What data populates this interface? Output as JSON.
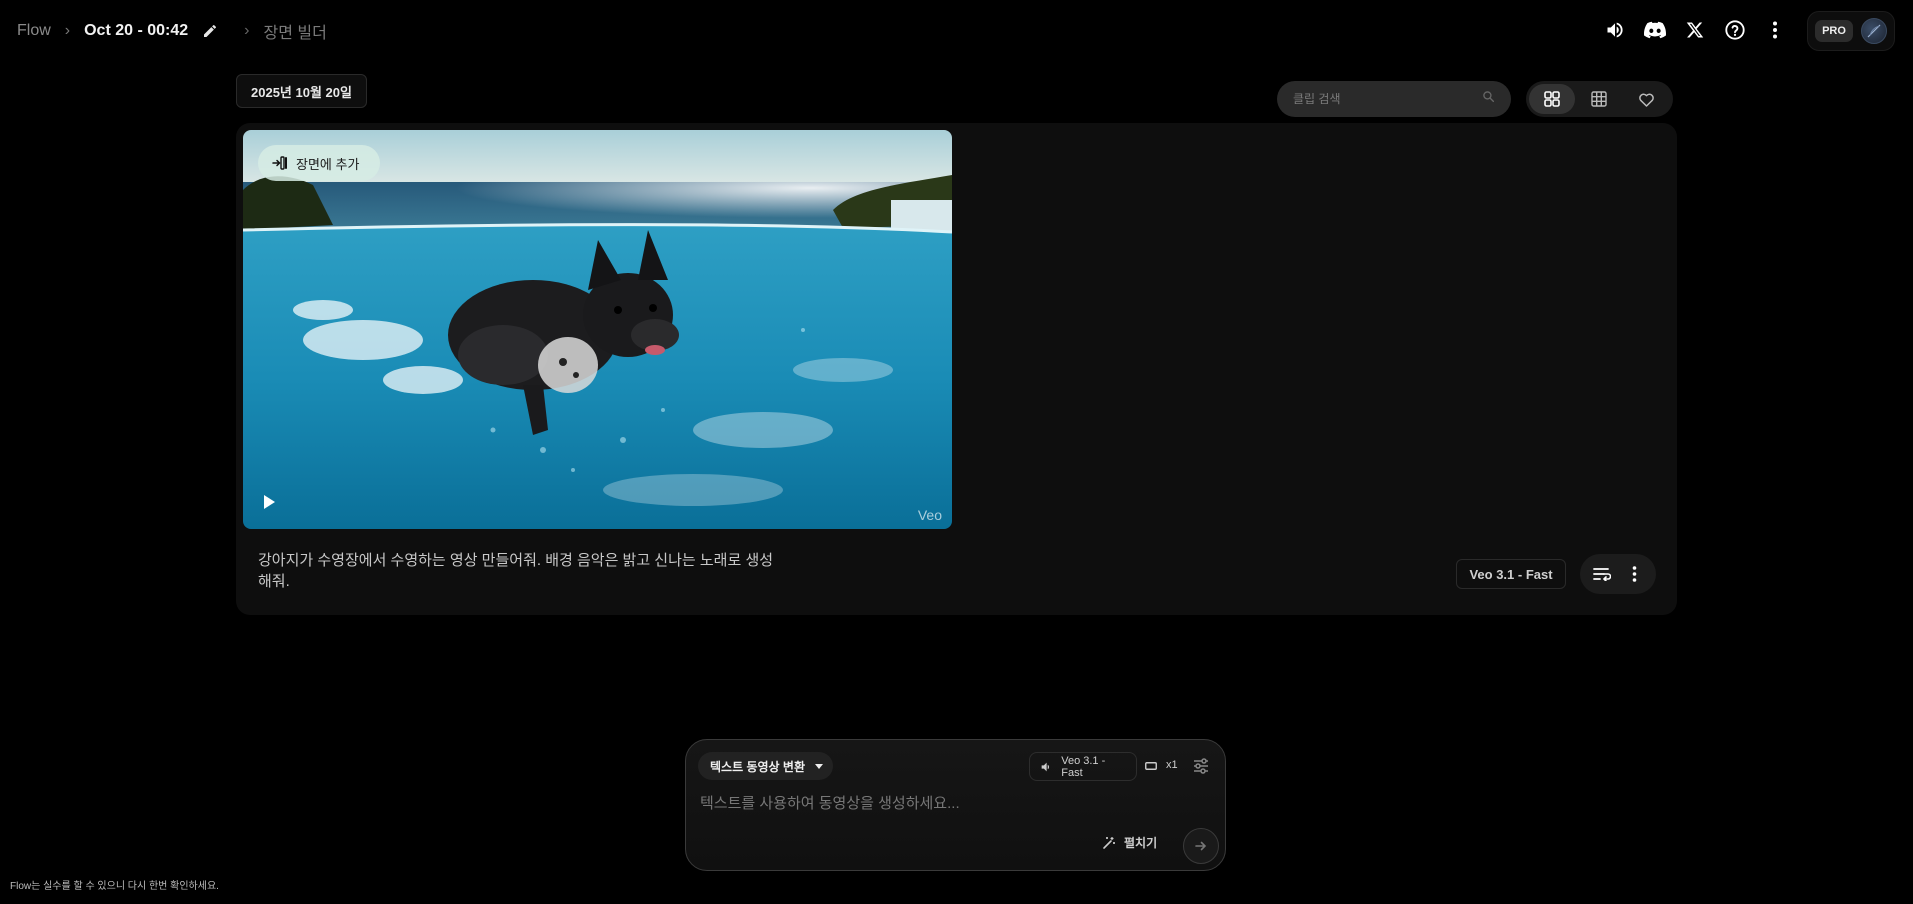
{
  "header": {
    "root": "Flow",
    "project_title": "Oct 20 - 00:42",
    "section": "장면 빌더",
    "pro_label": "PRO"
  },
  "icons": {
    "volume": "speaker-icon",
    "discord": "discord-icon",
    "x": "x-logo-icon",
    "help": "help-icon",
    "more": "kebab-menu-icon"
  },
  "toolbar": {
    "date": "2025년 10월 20일",
    "search_placeholder": "클립 검색"
  },
  "clip": {
    "add_to_scene": "장면에 추가",
    "watermark": "Veo",
    "prompt": "강아지가 수영장에서 수영하는 영상 만들어줘. 배경 음악은 밝고 신나는 노래로 생성해줘.",
    "model": "Veo 3.1 - Fast"
  },
  "composer": {
    "mode": "텍스트 동영상 변환",
    "model": "Veo 3.1 - Fast",
    "count": "x1",
    "placeholder": "텍스트를 사용하여 동영상을 생성하세요...",
    "expand": "펼치기"
  },
  "footer": {
    "note": "Flow는 실수를 할 수 있으니 다시 한번 확인하세요."
  },
  "colors": {
    "background": "#000000",
    "card": "#0e0e0e",
    "add_chip": "#d6ece4"
  }
}
